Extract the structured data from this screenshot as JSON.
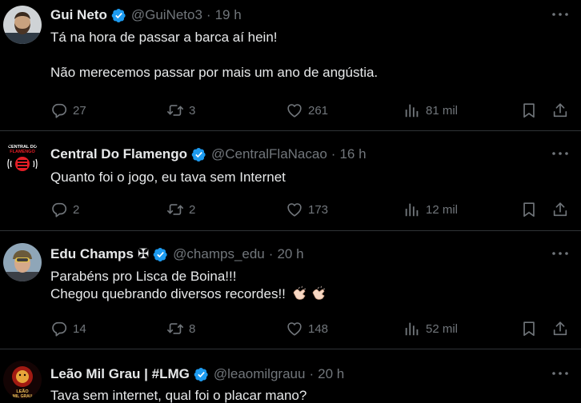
{
  "tweets": [
    {
      "name": "Gui Neto",
      "handle": "@GuiNeto3",
      "time": "19 h",
      "lines": [
        "Tá na hora de passar a barca aí hein!",
        "",
        "Não merecemos passar por mais um ano de angústia."
      ],
      "replies": "27",
      "retweets": "3",
      "likes": "261",
      "views": "81 mil"
    },
    {
      "name": "Central Do Flamengo",
      "handle": "@CentralFlaNacao",
      "time": "16 h",
      "lines": [
        "Quanto foi o jogo, eu tava sem Internet"
      ],
      "replies": "2",
      "retweets": "2",
      "likes": "173",
      "views": "12 mil",
      "avatar_text": "CENTRAL DO FLAMENGO"
    },
    {
      "name": "Edu Champs",
      "name_suffix": "✠",
      "handle": "@champs_edu",
      "time": "20 h",
      "lines": [
        "Parabéns pro Lisca de Boina!!!",
        "Chegou quebrando diversos recordes!!"
      ],
      "replies": "14",
      "retweets": "8",
      "likes": "148",
      "views": "52 mil"
    },
    {
      "name": "Leão Mil Grau | #LMG",
      "handle": "@leaomilgrauu",
      "time": "20 h",
      "lines": [
        "Tava sem internet, qual foi o placar mano?"
      ],
      "avatar_text": "LEÃO MIL GRAU"
    }
  ],
  "separator": "·",
  "icons": {
    "verified": "verified-badge-icon",
    "more": "more-options-icon",
    "reply": "reply-icon",
    "retweet": "retweet-icon",
    "like": "like-icon",
    "views": "views-icon",
    "bookmark": "bookmark-icon",
    "share": "share-icon",
    "clap": "clapping-hands-emoji"
  },
  "colors": {
    "background": "#000000",
    "text": "#e7e9ea",
    "muted": "#71767b",
    "verified": "#1d9bf0",
    "divider": "#2f3336"
  }
}
